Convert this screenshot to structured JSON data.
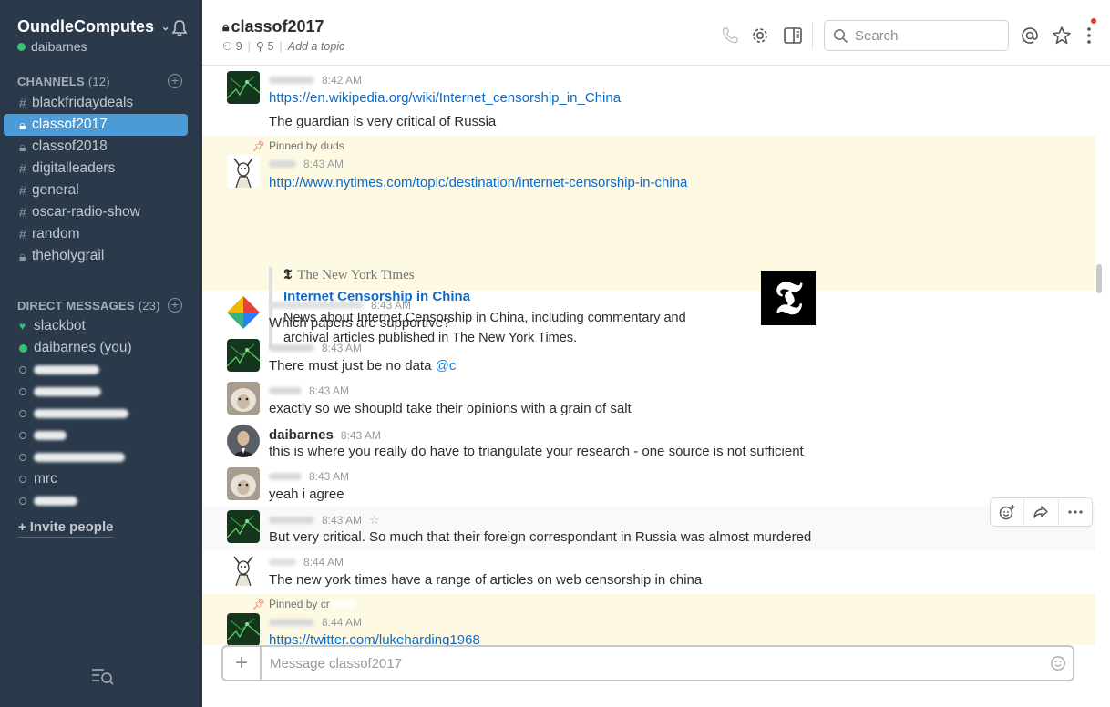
{
  "team": {
    "name": "OundleComputes",
    "user": "daibarnes"
  },
  "channels_section": {
    "label": "CHANNELS",
    "count": "(12)"
  },
  "channels": [
    {
      "prefix": "#",
      "name": "blackfridaydeals"
    },
    {
      "prefix": "🔒",
      "name": "classof2017",
      "active": true
    },
    {
      "prefix": "🔒",
      "name": "classof2018"
    },
    {
      "prefix": "#",
      "name": "digitalleaders"
    },
    {
      "prefix": "#",
      "name": "general"
    },
    {
      "prefix": "#",
      "name": "oscar-radio-show"
    },
    {
      "prefix": "#",
      "name": "random"
    },
    {
      "prefix": "🔒",
      "name": "theholygrail"
    }
  ],
  "dm_section": {
    "label": "DIRECT MESSAGES",
    "count": "(23)"
  },
  "dms": {
    "slackbot": "slackbot",
    "self": "daibarnes (you)",
    "mrc": "mrc"
  },
  "invite": "Invite people",
  "header": {
    "channel": "classof2017",
    "members": "9",
    "pins": "5",
    "topic": "Add a topic",
    "search_placeholder": "Search"
  },
  "messages": {
    "m1": {
      "time": "8:42 AM",
      "link": "https://en.wikipedia.org/wiki/Internet_censorship_in_China",
      "text": "The guardian is very critical of Russia"
    },
    "m2": {
      "pinned": "Pinned by duds",
      "time": "8:43 AM",
      "link": "http://www.nytimes.com/topic/destination/internet-censorship-in-china",
      "unfurl_source": "The New York Times",
      "unfurl_title": "Internet Censorship in China",
      "unfurl_desc": "News about Internet Censorship in China, including commentary and archival articles published in The New York Times."
    },
    "m3": {
      "time": "8:43 AM",
      "text": "Which papers are supportive?"
    },
    "m4": {
      "time": "8:43 AM",
      "text": "There must just be no data",
      "mention": "@c"
    },
    "m5": {
      "time": "8:43 AM",
      "text": "exactly so we shoupld take their opinions with a grain of salt"
    },
    "m6": {
      "name": "daibarnes",
      "time": "8:43 AM",
      "text": "this is where you really do have to triangulate your research - one source is not sufficient"
    },
    "m7": {
      "time": "8:43 AM",
      "text": "yeah i agree"
    },
    "m8": {
      "time": "8:43 AM",
      "text": "But very critical. So much that their foreign correspondant in Russia was almost murdered"
    },
    "m9": {
      "time": "8:44 AM",
      "text": "The new york times have a range of articles on web censorship in china"
    },
    "m10": {
      "pinned": "Pinned by cr",
      "time": "8:44 AM",
      "link": "https://twitter.com/lukeharding1968"
    }
  },
  "composer": {
    "placeholder": "Message classof2017"
  },
  "colors": {
    "sidebar": "#2b3a4a",
    "active": "#4c9ad6",
    "pinned_bg": "#fdf9e3",
    "link": "#0b6bc9",
    "presence": "#38c172"
  }
}
